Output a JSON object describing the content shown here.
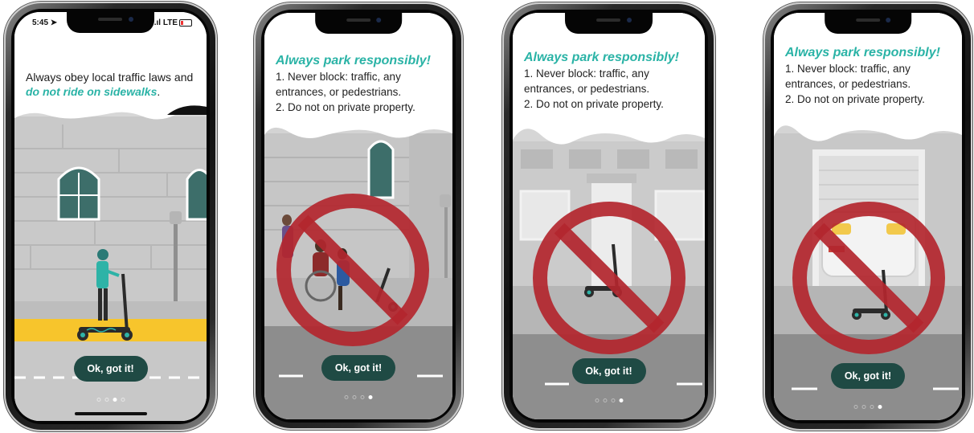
{
  "screens": [
    {
      "status_time": "5:45 ➤",
      "status_signal": ".ıl LTE",
      "message_plain": "Always obey local traffic laws and",
      "message_emphasis": "do not ride on sidewalks",
      "message_end": ".",
      "button_label": "Ok, got it!",
      "pages": 4,
      "active_page": 3
    },
    {
      "title": "Always park responsibly!",
      "rules": [
        "1. Never block: traffic, any",
        "entrances, or pedestrians.",
        "2. Do not on private property."
      ],
      "button_label": "Ok, got it!",
      "pages": 4,
      "active_page": 4
    },
    {
      "title": "Always park responsibly!",
      "rules": [
        "1. Never block: traffic, any",
        "entrances, or pedestrians.",
        "2. Do not on private property."
      ],
      "button_label": "Ok, got it!",
      "pages": 4,
      "active_page": 4
    },
    {
      "title": "Always park responsibly!",
      "rules": [
        "1. Never block: traffic, any",
        "entrances, or pedestrians.",
        "2. Do not on private property."
      ],
      "button_label": "Ok, got it!",
      "pages": 4,
      "active_page": 4
    }
  ],
  "colors": {
    "accent": "#2ab3a6",
    "button": "#1f4a44",
    "prohibition": "#b3262e",
    "sidewalk_highlight": "#f7c52c"
  }
}
